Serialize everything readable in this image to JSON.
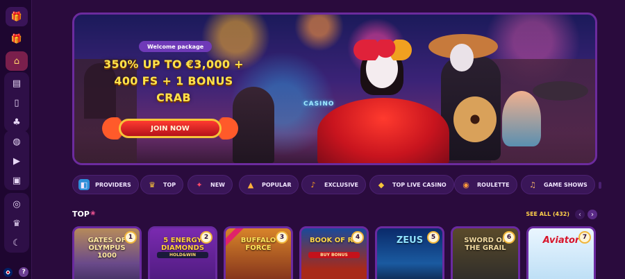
{
  "sidebar": {
    "top_icons": [
      "gift-box-icon",
      "gift-icon",
      "home-icon"
    ],
    "mid_icons": [
      "slot-machine-icon",
      "card-icon",
      "clover-icon"
    ],
    "group2_icons": [
      "ball-icon",
      "play-icon",
      "live-camera-icon"
    ],
    "group3_icons": [
      "medal-icon",
      "trophy-icon",
      "boomerang-icon"
    ],
    "help_label": "?"
  },
  "hero": {
    "badge": "Welcome package",
    "promo_line1": "350% UP TO €3,000 +",
    "promo_line2": "400 FS + 1 BONUS",
    "promo_line3": "CRAB",
    "cta": "JOIN NOW",
    "sign": "CASINO"
  },
  "categories": [
    {
      "label": "PROVIDERS",
      "icon": "providers-icon"
    },
    {
      "label": "TOP",
      "icon": "trophy-icon"
    },
    {
      "label": "NEW",
      "icon": "new-icon"
    },
    {
      "label": "POPULAR",
      "icon": "popular-icon"
    },
    {
      "label": "EXCLUSIVE",
      "icon": "maracas-icon"
    },
    {
      "label": "TOP LIVE CASINO",
      "icon": "live-casino-icon"
    },
    {
      "label": "ROULETTE",
      "icon": "roulette-icon"
    },
    {
      "label": "GAME SHOWS",
      "icon": "guitar-icon"
    }
  ],
  "top_section": {
    "title": "TOP",
    "see_all": "SEE ALL (432)",
    "prev": "‹",
    "next": "›"
  },
  "games": [
    {
      "rank": "1",
      "name": "GATES OF OLYMPUS 1000",
      "sub": ""
    },
    {
      "rank": "2",
      "name": "5 ENERGY DIAMONDS",
      "sub": "HOLD&WIN"
    },
    {
      "rank": "3",
      "name": "BUFFALO FORCE",
      "sub": ""
    },
    {
      "rank": "4",
      "name": "BOOK OF RA",
      "sub": "BUY BONUS"
    },
    {
      "rank": "5",
      "name": "ZEUS",
      "sub": ""
    },
    {
      "rank": "6",
      "name": "SWORD OF THE GRAIL",
      "sub": ""
    },
    {
      "rank": "7",
      "name": "Aviator",
      "sub": ""
    }
  ],
  "colors": {
    "background": "#2a0b3d",
    "sidebar": "#1e0630",
    "accent_gold": "#ffd04a",
    "promo_yellow": "#ffe24a",
    "cta_red": "#d81f26",
    "pill_purple": "#6f3ab8"
  }
}
